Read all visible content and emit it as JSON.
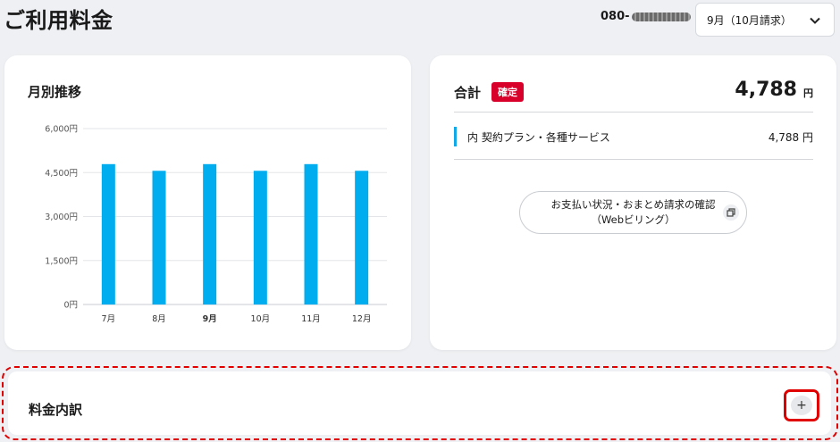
{
  "header": {
    "title": "ご利用料金",
    "phone_prefix": "080-",
    "month_select": {
      "value": "9月（10月請求）"
    }
  },
  "monthly": {
    "title": "月別推移"
  },
  "chart_data": {
    "type": "bar",
    "title": "月別推移",
    "categories": [
      "7月",
      "8月",
      "9月",
      "10月",
      "11月",
      "12月"
    ],
    "series": [
      {
        "values": [
          4788,
          4560,
          4788,
          4560,
          4788,
          4560
        ]
      }
    ],
    "y_ticks": [
      "6,000円",
      "4,500円",
      "3,000円",
      "1,500円",
      "0円"
    ],
    "ylim": [
      0,
      6000
    ],
    "highlight_category": "9月",
    "bar_color": "#00adef",
    "grid": true
  },
  "summary": {
    "total_label": "合計",
    "badge": "確定",
    "total_amount": "4,788",
    "unit": "円",
    "items": [
      {
        "label": "内 契約プラン・各種サービス",
        "amount": "4,788 円"
      }
    ],
    "payment_button": {
      "line1": "お支払い状況・おまとめ請求の確認",
      "line2": "（Webビリング）"
    }
  },
  "breakdown": {
    "title": "料金内訳",
    "expand_icon": "plus-icon",
    "expand_symbol": "+"
  },
  "colors": {
    "accent": "#00adef",
    "badge": "#d8002a",
    "highlight": "#e00000"
  }
}
